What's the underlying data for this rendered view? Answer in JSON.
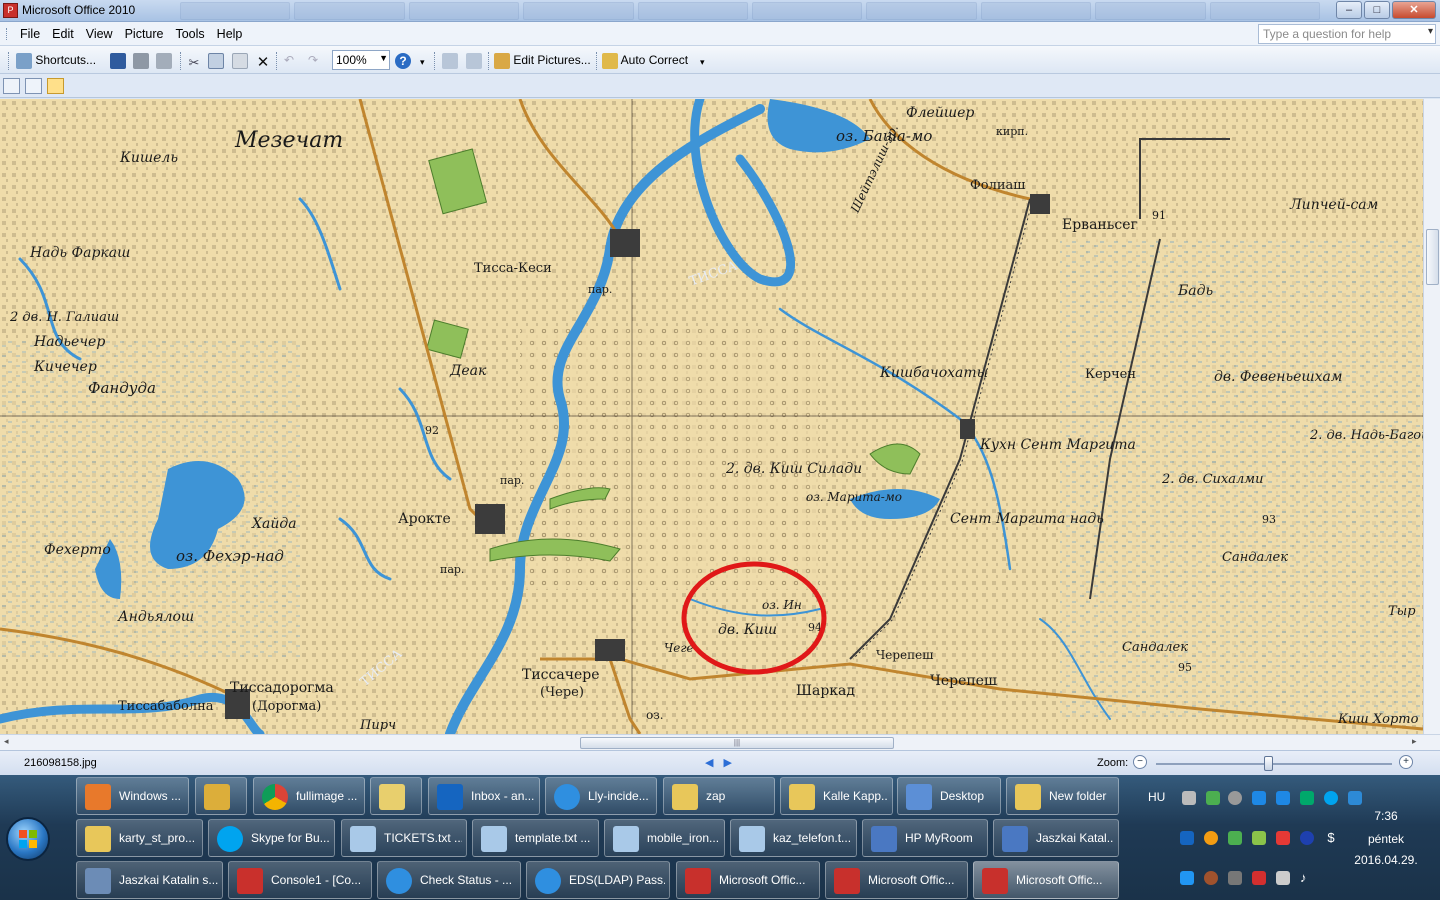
{
  "window": {
    "title": "Microsoft Office 2010",
    "minimize": "–",
    "maximize": "□",
    "close": "✕"
  },
  "menu": [
    "File",
    "Edit",
    "View",
    "Picture",
    "Tools",
    "Help"
  ],
  "help_placeholder": "Type a question for help",
  "toolbar": {
    "shortcuts": "Shortcuts...",
    "zoom": "100%",
    "edit_pictures": "Edit Pictures...",
    "auto_correct": "Auto Correct"
  },
  "map_labels": {
    "mezechat": "Мезечат",
    "kishel": "Кишель",
    "nad_farkash": "Надь Фаркаш",
    "dv_n_galiash": "2 дв. Н. Галиаш",
    "nadvecher": "Надьечер",
    "kichecher": "Кичечер",
    "fanduda": "Фандуда",
    "tissa_kesi": "Тисса-Кеси",
    "deak": "Деак",
    "tissa_river_1": "ТИССА",
    "tissa_river_2": "ТИССА",
    "aroktie": "Арокте",
    "haida": "Хайда",
    "feherto": "Фехерто",
    "oz_feher_nad": "оз. Фехэр-над",
    "andyalosh": "Андьялош",
    "tissadorogma": "Тиссадорогма",
    "doroгma": "(Дорогма)",
    "tissabaбolna": "Тиссабаболна",
    "pirch": "Пирч",
    "tissachere": "Тиссачере",
    "chere": "(Чере)",
    "oz_basha_mo": "оз. Баша-мо",
    "fleishner": "Флейшер",
    "folyash": "Фолиаш",
    "shelyon": "Шейтэлиш-эр.",
    "ervanyseg": "Ерваньсег",
    "lipchei_sam": "Липчей-сам",
    "bad": "Бадь",
    "kishbochohati": "Кишбачохаты",
    "kerchen": "Керчен",
    "dv_feventyehsham": "дв. Февеньешхам",
    "kuh_sent_marita": "Кухн Сент Маргита",
    "dv_nad_bagoi": "2. дв. Надь-Багой",
    "dv_kish_siladi": "2. дв. Киш Силади",
    "oz_marita_mo": "оз. Марита-мо",
    "sent_marita_nad": "Сент Маргита надь",
    "dv_sihalmi": "2. дв. Сихалми",
    "sandalek_1": "Сандалек",
    "sandalek_2": "Сандалек",
    "dv_kish": "дв. Киш",
    "oz_in": "оз. Ин",
    "cherepesh_1": "Черепеш",
    "cherepesh_2": "Черепеш",
    "sharkad": "Шаркад",
    "kish_horto": "Киш Хорто",
    "tyr": "Тыр",
    "chege": "Чеге",
    "par": "пар.",
    "kirp": "кирп.",
    "oz": "оз.",
    "n92": "92",
    "n93": "93",
    "n91": "91",
    "n94": "94",
    "n95": "95"
  },
  "status": {
    "filename": "216098158.jpg",
    "nav": "◀▶",
    "zoom_label": "Zoom:",
    "zoom_level": 0.48
  },
  "taskbar": {
    "row1": [
      "Windows ...",
      "",
      "fullimage ...",
      "",
      "Inbox - an...",
      "Lly-incide...",
      "zap",
      "Kalle Kapp...",
      "Desktop",
      "New folder"
    ],
    "row2": [
      "karty_st_pro...",
      "Skype for Bu...",
      "TICKETS.txt ...",
      "template.txt ...",
      "mobile_iron...",
      "kaz_telefon.t...",
      "HP MyRoom",
      "Jaszkai Katal..."
    ],
    "row3": [
      "Jaszkai Katalin s...",
      "Console1 - [Co...",
      "Check Status - ...",
      "EDS(LDAP) Pass...",
      "Microsoft Offic...",
      "Microsoft Offic...",
      "Microsoft Offic..."
    ],
    "lang": "HU",
    "time": "7:36",
    "day": "péntek",
    "date": "2016.04.29."
  },
  "colors": {
    "map_bg": "#efdcaa",
    "water": "#3e94d6",
    "road": "#c0852e",
    "marker": "#e01818"
  }
}
